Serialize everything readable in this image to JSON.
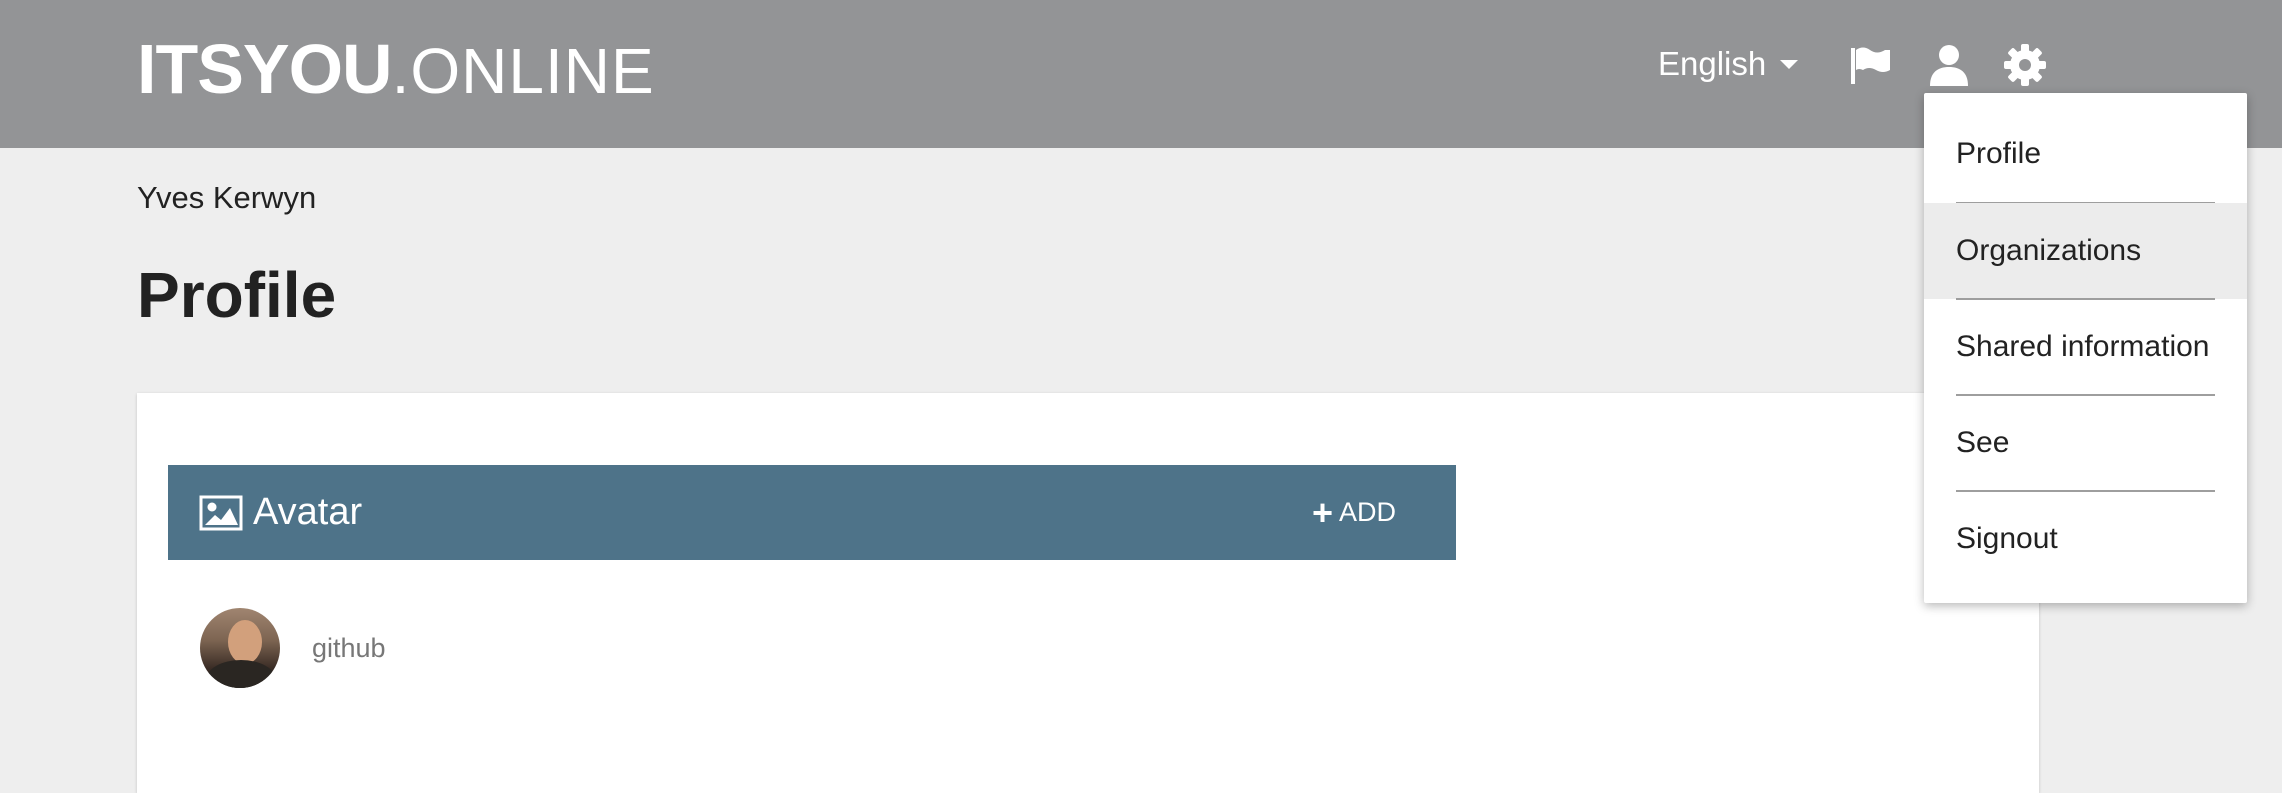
{
  "header": {
    "logo_bold": "ITSYOU",
    "logo_thin": ".ONLINE",
    "language": "English",
    "icons": [
      "flag-icon",
      "user-icon",
      "gear-icon"
    ],
    "background_color": "#939496"
  },
  "user": {
    "name": "Yves Kerwyn"
  },
  "page": {
    "title": "Profile"
  },
  "avatar_section": {
    "title": "Avatar",
    "add_label": "ADD",
    "header_color": "#4e7389",
    "items": [
      {
        "label": "github"
      }
    ]
  },
  "user_menu": {
    "items": [
      {
        "label": "Profile"
      },
      {
        "label": "Organizations",
        "highlighted": true
      },
      {
        "label": "Shared information"
      },
      {
        "label": "See"
      },
      {
        "label": "Signout"
      }
    ]
  }
}
